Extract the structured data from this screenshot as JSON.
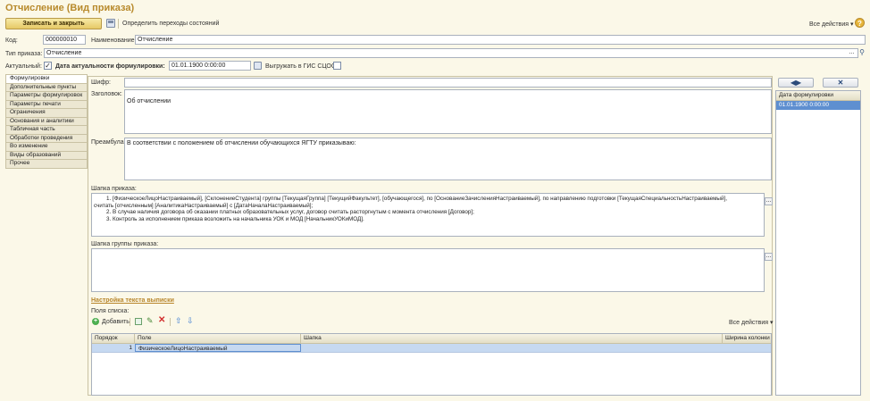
{
  "window": {
    "title": "Отчисление (Вид приказа)"
  },
  "toolbar": {
    "save_close": "Записать и закрыть",
    "define_transitions": "Определить переходы состояний",
    "all_actions": "Все действия",
    "help": "?"
  },
  "header": {
    "code_label": "Код:",
    "code_value": "000000010",
    "name_label": "Наименование:",
    "name_value": "Отчисление",
    "order_type_label": "Тип приказа:",
    "order_type_value": "Отчисление",
    "actual_label": "Актуальный:",
    "date_label": "Дата актуальности формулировки:",
    "date_value": "01.01.1900  0:00:00",
    "gis_label": "Выгружать в ГИС СЦОС:"
  },
  "tabs": [
    "Формулировки",
    "Дополнительные пункты",
    "Параметры формулировок",
    "Параметры печати",
    "Ограничения",
    "Основания и аналитики",
    "Табличная часть",
    "Обработки проведения",
    "Во изменение",
    "Виды образований",
    "Прочее"
  ],
  "form": {
    "cipher_label": "Шифр:",
    "cipher_value": "",
    "heading_label": "Заголовок:",
    "heading_value": "Об отчислении",
    "preamble_label": "Преамбула:",
    "preamble_value": "В соответствии с положением об отчислении обучающихся ЯГТУ приказываю:",
    "order_header_label": "Шапка приказа:",
    "order_header_lines": [
      "1. [ФизическоеЛицоНастраиваемый], [СклонениеСтудента] группы [ТекущаяГруппа] [ТекущийФакультет], [обучающегося], по [ОснованиеЗачисленияНастраиваемый], по направлению подготовки [ТекущаяСпециальностьНастраиваемый],",
      "считать [отчисленным] [АналитикаНастраиваемый] с [ДатаНачалаНастраиваемый];",
      "2. В случае наличия договора об оказании платных образовательных услуг, договор считать расторгнутым с момента отчисления [Договор];",
      "3. Контроль за исполнением приказа возложить на начальника УОК и МОД [НачальникУОКиМОД]."
    ],
    "group_header_label": "Шапка группы приказа:",
    "group_header_value": "",
    "statement_link": "Настройка текста выписки",
    "list_fields_label": "Поля списка:",
    "add_button": "Добавить",
    "all_actions": "Все действия"
  },
  "grid": {
    "columns": [
      "Порядок",
      "Поле",
      "Шапка",
      "Ширина колонки"
    ],
    "rows": [
      {
        "order": "1",
        "field": "ФизическоеЛицоНастраиваемый",
        "header": "",
        "width": ""
      }
    ]
  },
  "right_panel": {
    "column_header": "Дата формулировки",
    "rows": [
      "01.01.1900 0:00:00"
    ]
  },
  "colors": {
    "title": "#b88a2c",
    "background": "#fbf8e8",
    "selection": "#5e8fd0"
  }
}
